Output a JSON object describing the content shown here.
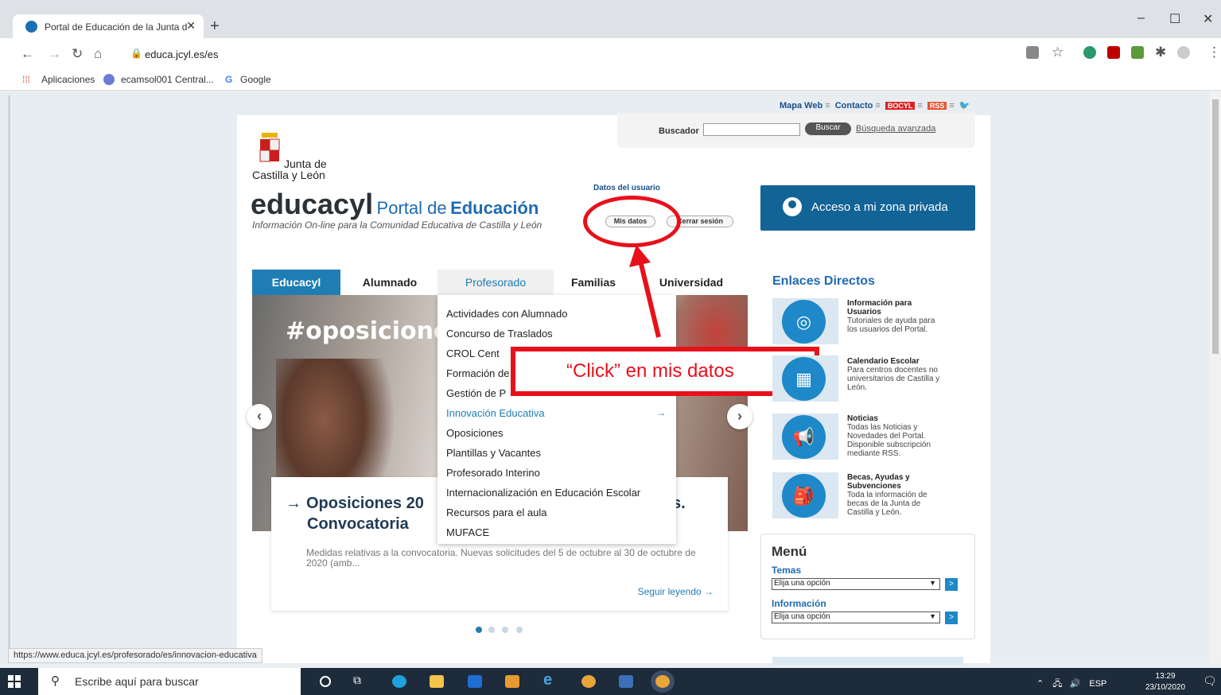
{
  "browser": {
    "tab_title": "Portal de Educación de la Junta d",
    "url": "educa.jcyl.es/es",
    "bookmarks": [
      "Aplicaciones",
      "ecamsol001 Central...",
      "Google"
    ],
    "status_url": "https://www.educa.jcyl.es/profesorado/es/innovacion-educativa"
  },
  "header": {
    "toplinks": [
      "Mapa Web",
      "Contacto",
      "BOCYL",
      "RSS"
    ],
    "search_label": "Buscador",
    "search_value": "",
    "search_button": "Buscar",
    "advanced_search": "Búsqueda avanzada",
    "junta_line1": "Junta de",
    "junta_line2": "Castilla y León",
    "brand_main": "educacyl",
    "brand_portal": "Portal de",
    "brand_edu": "Educación",
    "tagline": "Información On-line para la Comunidad Educativa de Castilla y León",
    "user_data_label": "Datos del usuario",
    "mis_datos": "Mis datos",
    "cerrar_sesion": "Cerrar sesión",
    "private_zone": "Acceso a mi zona privada"
  },
  "nav": {
    "tabs": [
      "Educacyl",
      "Alumnado",
      "Profesorado",
      "Familias",
      "Universidad"
    ],
    "active": "Educacyl",
    "open": "Profesorado"
  },
  "dropdown": {
    "items": [
      "Actividades con Alumnado",
      "Concurso de Traslados",
      "CROL  Cent",
      "Formación de",
      "Gestión de P",
      "Innovación Educativa",
      "Oposiciones",
      "Plantillas y Vacantes",
      "Profesorado Interino",
      "Internacionalización en Educación Escolar",
      "Recursos para el aula",
      "MUFACE"
    ],
    "highlighted": "Innovación Educativa"
  },
  "slide": {
    "hashtag": "#oposiciones",
    "title_prefix": "Oposiciones 20",
    "title_suffix": "os.",
    "title_line2": "Convocatoria",
    "body": "Medidas relativas a la convocatoria. Nuevas solicitudes del 5 de octubre al 30 de octubre de 2020 (amb...",
    "more": "Seguir leyendo →",
    "dots": 4
  },
  "annotation": {
    "text": "“Click” en mis datos",
    "color": "#e8101a"
  },
  "enlaces": {
    "title": "Enlaces Directos",
    "items": [
      {
        "title": "Información para Usuarios",
        "desc": "Tutoriales de ayuda para los usuarios del Portal.",
        "icon": "lifebuoy-icon"
      },
      {
        "title": "Calendario Escolar",
        "desc": "Para centros docentes no universitarios de Castilla y León.",
        "icon": "calendar-icon"
      },
      {
        "title": "Noticias",
        "desc": "Todas las Noticias y Novedades del Portal. Disponible subscripción mediante RSS.",
        "icon": "megaphone-icon"
      },
      {
        "title": "Becas, Ayudas y Subvenciones",
        "desc": "Toda la información de becas de la Junta de Castilla y León.",
        "icon": "backpack-icon"
      }
    ]
  },
  "menu": {
    "title": "Menú",
    "temas_label": "Temas",
    "temas_value": "Elija una opción",
    "info_label": "Información",
    "info_value": "Elija una opción"
  },
  "taskbar": {
    "search_placeholder": "Escribe aquí para buscar",
    "lang": "ESP",
    "time": "13:29",
    "date": "23/10/2020"
  },
  "colors": {
    "brand_blue": "#1f7db4",
    "private_btn": "#126396",
    "annotation_red": "#e8101a"
  }
}
